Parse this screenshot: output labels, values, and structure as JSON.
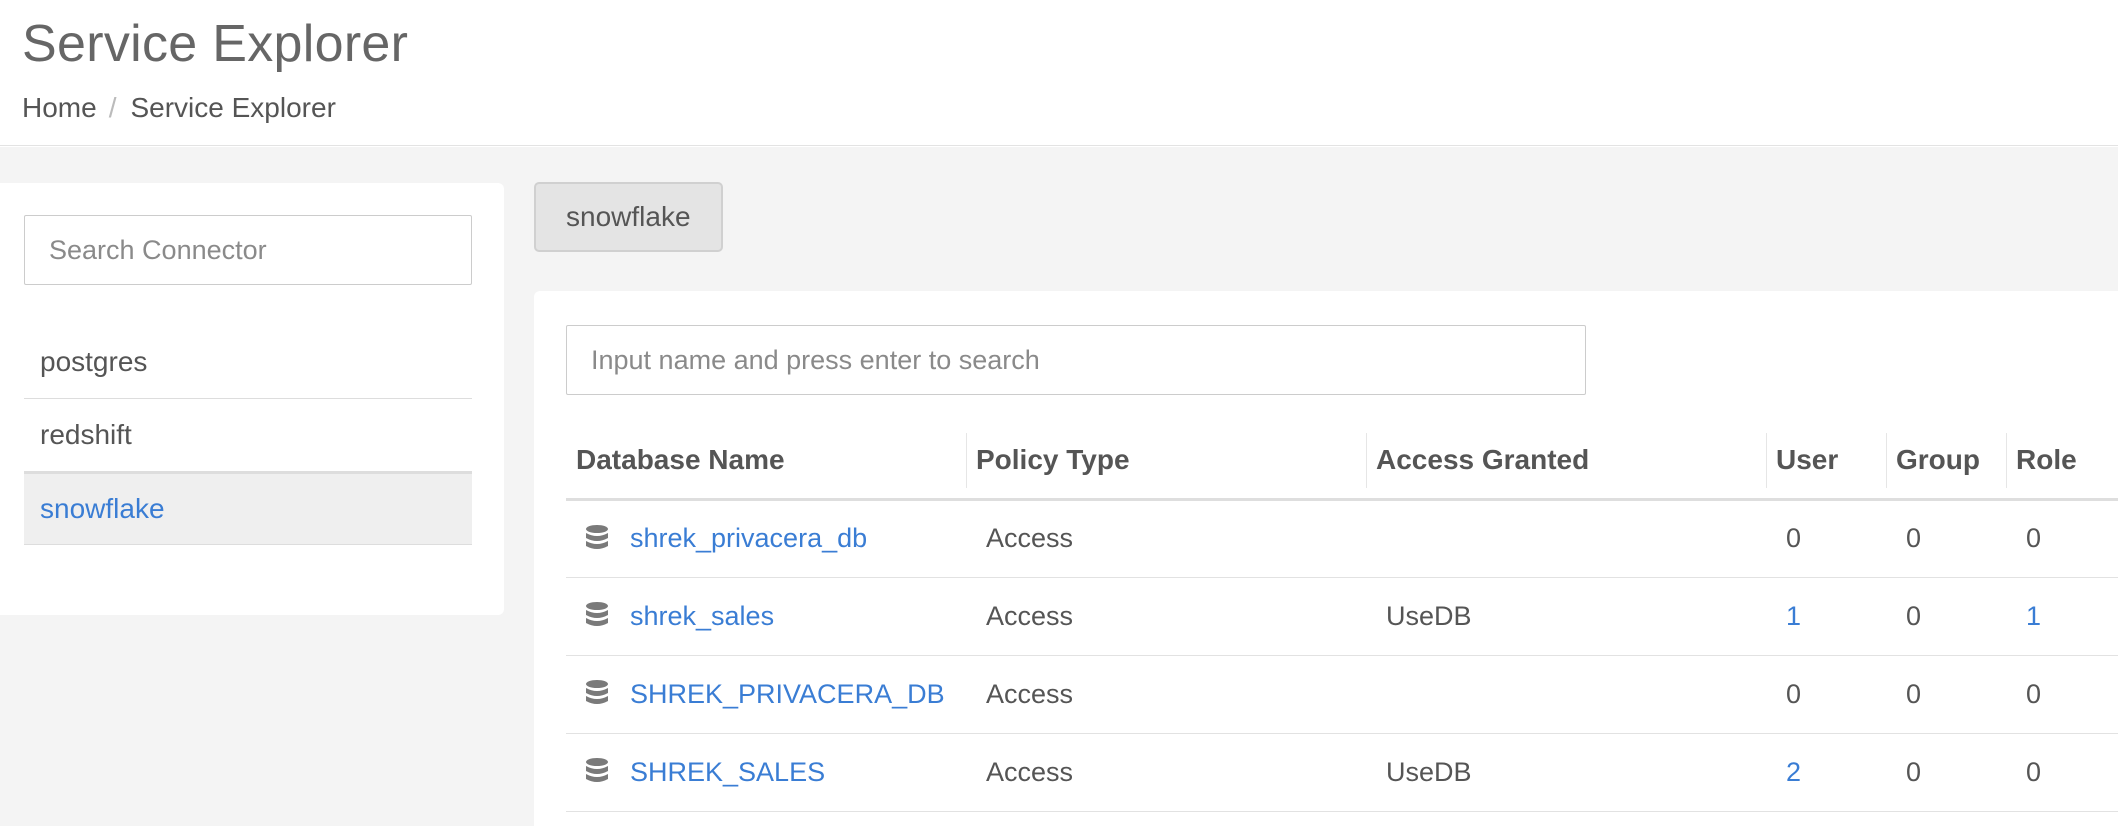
{
  "header": {
    "title": "Service Explorer",
    "breadcrumb": {
      "home": "Home",
      "separator": "/",
      "current": "Service Explorer"
    }
  },
  "sidebar": {
    "search_placeholder": "Search Connector",
    "connectors": [
      {
        "label": "postgres",
        "active": false
      },
      {
        "label": "redshift",
        "active": false
      },
      {
        "label": "snowflake",
        "active": true
      }
    ]
  },
  "main": {
    "selected_tab": "snowflake",
    "search_placeholder": "Input name and press enter to search",
    "columns": [
      "Database Name",
      "Policy Type",
      "Access Granted",
      "User",
      "Group",
      "Role"
    ],
    "rows": [
      {
        "name": "shrek_privacera_db",
        "policy_type": "Access",
        "access_granted": "",
        "user": "0",
        "group": "0",
        "role": "0"
      },
      {
        "name": "shrek_sales",
        "policy_type": "Access",
        "access_granted": "UseDB",
        "user": "1",
        "group": "0",
        "role": "1"
      },
      {
        "name": "SHREK_PRIVACERA_DB",
        "policy_type": "Access",
        "access_granted": "",
        "user": "0",
        "group": "0",
        "role": "0"
      },
      {
        "name": "SHREK_SALES",
        "policy_type": "Access",
        "access_granted": "UseDB",
        "user": "2",
        "group": "0",
        "role": "0"
      }
    ]
  },
  "colors": {
    "link": "#3a7dd4",
    "text": "#555555",
    "background": "#f4f4f4"
  },
  "icons": {
    "row_icon": "database-icon"
  }
}
